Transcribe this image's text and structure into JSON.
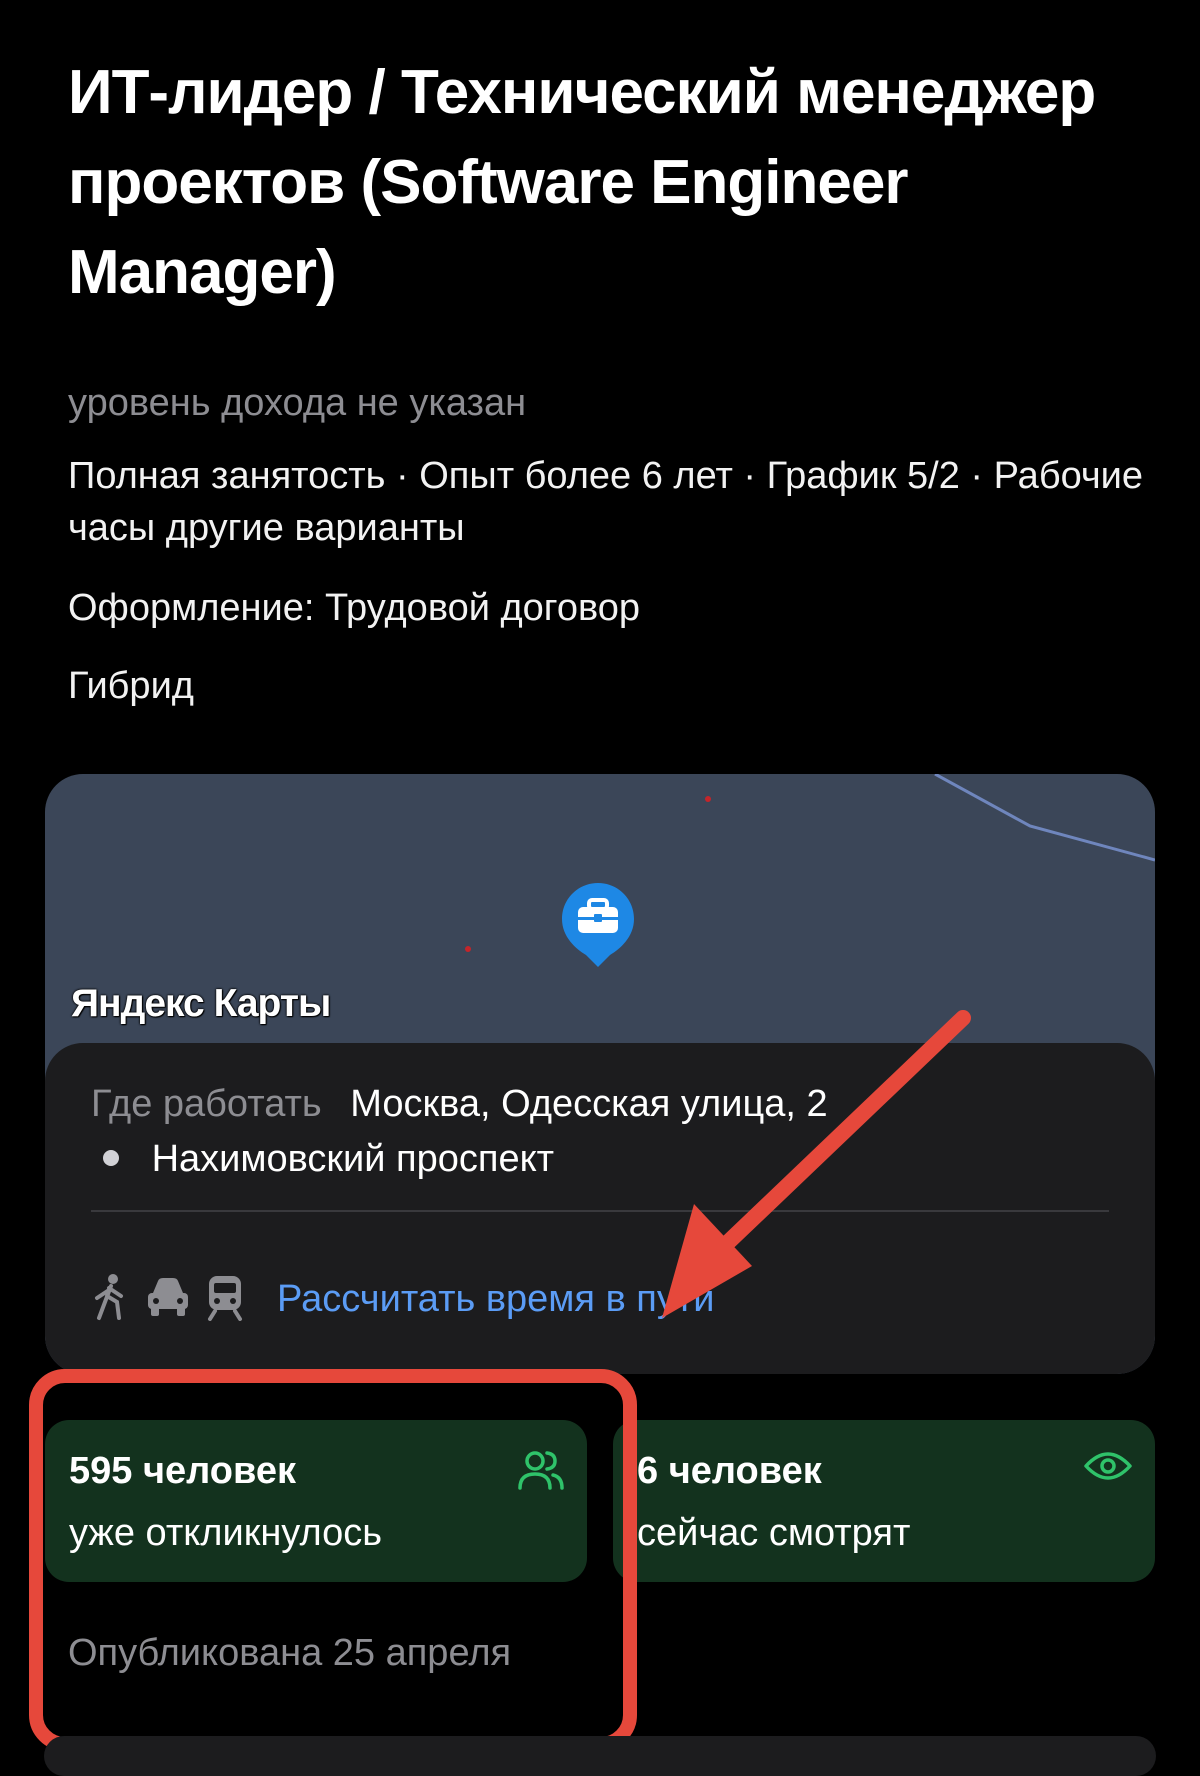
{
  "vacancy": {
    "title": "ИТ-лидер / Технический менеджер проектов (Software Engineer Manager)",
    "salary": "уровень дохода не указан",
    "conditions": "Полная занятость · Опыт более 6 лет · График 5/2 · Рабочие часы другие варианты",
    "contract": "Оформление: Трудовой договор",
    "format": "Гибрид"
  },
  "map": {
    "brand": "Яндекс Карты",
    "pin_icon": "briefcase-icon",
    "colors": {
      "background": "#3b4658",
      "pin": "#1e88e5",
      "road": "#6f86bd"
    }
  },
  "address": {
    "label": "Где работать",
    "value": "Москва, Одесская улица, 2",
    "metro": "Нахимовский проспект",
    "transport_icons": [
      "walk-icon",
      "car-icon",
      "train-icon"
    ],
    "route_link": "Рассчитать время в пути"
  },
  "stats": {
    "responses": {
      "count": "595 человек",
      "text": "уже откликнулось",
      "icon": "people-icon"
    },
    "viewers": {
      "count": "6 человек",
      "text": "сейчас смотрят",
      "icon": "eye-icon"
    }
  },
  "published": "Опубликована 25 апреля",
  "annotations": {
    "color": "#e6483b"
  }
}
